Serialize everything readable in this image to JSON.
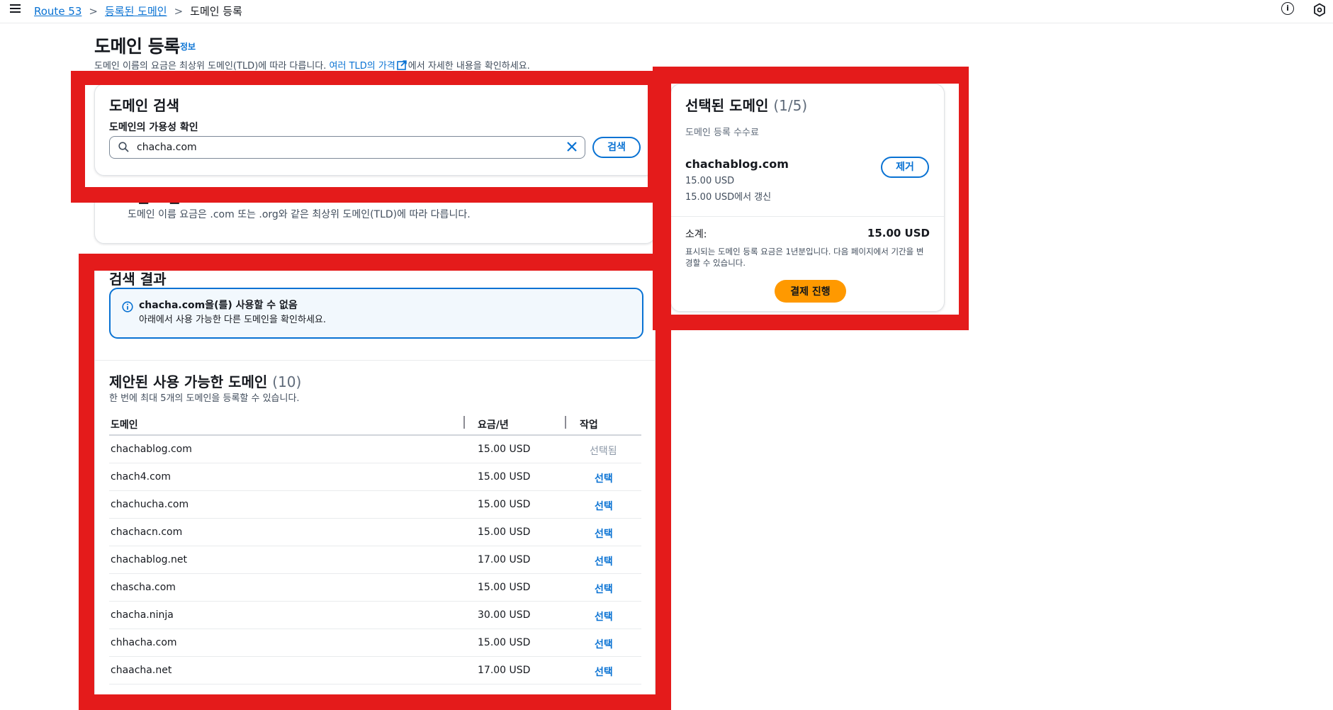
{
  "breadcrumb": {
    "item1": "Route 53",
    "item2": "등록된 도메인",
    "current": "도메인 등록"
  },
  "page": {
    "title": "도메인 등록",
    "info_link": "정보",
    "desc_prefix": "도메인 이름의 요금은 최상위 도메인(TLD)에 따라 다릅니다. ",
    "desc_link": "여러 TLD의 가격",
    "desc_suffix": "에서 자세한 내용을 확인하세요."
  },
  "search": {
    "title": "도메인 검색",
    "label": "도메인의 가용성 확인",
    "value": "chacha.com",
    "button": "검색"
  },
  "pricing": {
    "title": "표준 요금",
    "desc": "도메인 이름 요금은 .com 또는 .org와 같은 최상위 도메인(TLD)에 따라 다릅니다."
  },
  "results": {
    "title": "검색 결과",
    "alert_title": "chacha.com을(를) 사용할 수 없음",
    "alert_desc": "아래에서 사용 가능한 다른 도메인을 확인하세요.",
    "suggested_title": "제안된 사용 가능한 도메인",
    "suggested_count": "(10)",
    "suggested_desc": "한 번에 최대 5개의 도메인을 등록할 수 있습니다.",
    "columns": {
      "domain": "도메인",
      "price": "요금/년",
      "action": "작업"
    },
    "rows": [
      {
        "domain": "chachablog.com",
        "price": "15.00 USD",
        "action": "선택됨"
      },
      {
        "domain": "chach4.com",
        "price": "15.00 USD",
        "action": "선택"
      },
      {
        "domain": "chachucha.com",
        "price": "15.00 USD",
        "action": "선택"
      },
      {
        "domain": "chachacn.com",
        "price": "15.00 USD",
        "action": "선택"
      },
      {
        "domain": "chachablog.net",
        "price": "17.00 USD",
        "action": "선택"
      },
      {
        "domain": "chascha.com",
        "price": "15.00 USD",
        "action": "선택"
      },
      {
        "domain": "chacha.ninja",
        "price": "30.00 USD",
        "action": "선택"
      },
      {
        "domain": "chhacha.com",
        "price": "15.00 USD",
        "action": "선택"
      },
      {
        "domain": "chaacha.net",
        "price": "17.00 USD",
        "action": "선택"
      }
    ]
  },
  "selected": {
    "title": "선택된 도메인",
    "count": "(1/5)",
    "subtitle": "도메인 등록 수수료",
    "domain": "chachablog.com",
    "price": "15.00 USD",
    "renew": "15.00 USD에서 갱신",
    "remove_button": "제거",
    "subtotal_label": "소계:",
    "subtotal_value": "15.00 USD",
    "note": "표시되는 도메인 등록 요금은 1년분입니다. 다음 페이지에서 기간을 변경할 수 있습니다.",
    "checkout_button": "결제 진행"
  },
  "colors": {
    "link": "#0972d3",
    "primary_button": "#ff9900",
    "annotation": "#e41b1b"
  }
}
